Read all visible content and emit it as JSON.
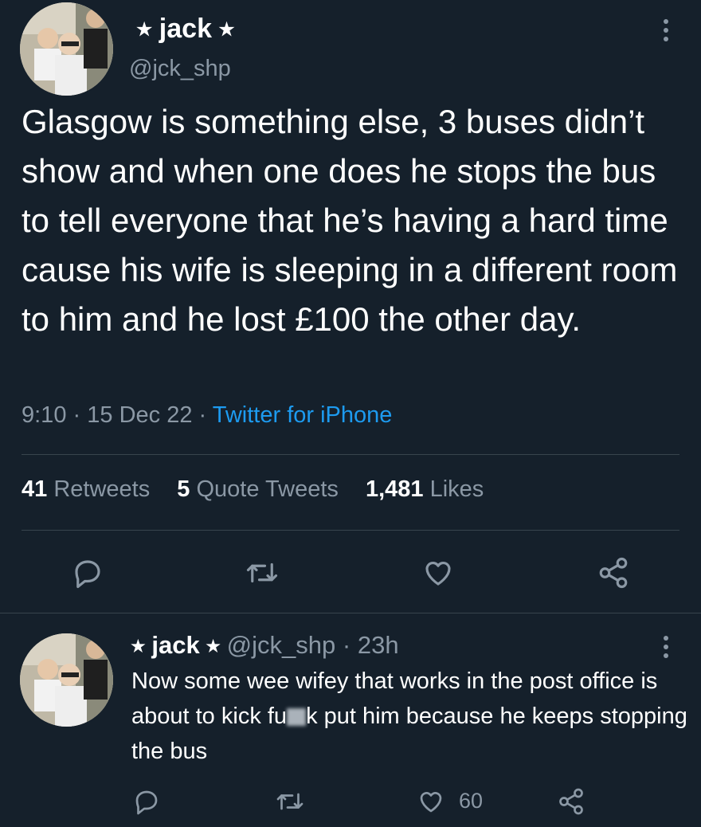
{
  "tweet": {
    "display_name": "⭑ jack ⭑",
    "handle": "@jck_shp",
    "text": "Glasgow is something else, 3 buses didn’t show and when one does he stops the bus to tell everyone that he’s having a hard time cause his wife is sleeping in a different room to him and he lost £100 the other day.",
    "time": "9:10",
    "date": "15 Dec 22",
    "separator": "·",
    "source": "Twitter for iPhone",
    "stats": {
      "retweets_count": "41",
      "retweets_label": "Retweets",
      "quotes_count": "5",
      "quotes_label": "Quote Tweets",
      "likes_count": "1,481",
      "likes_label": "Likes"
    }
  },
  "reply": {
    "display_name": "⭑ jack ⭑",
    "handle": "@jck_shp",
    "separator": "·",
    "age": "23h",
    "text_part1": "Now some wee wifey that works in the post office is about to kick fu",
    "text_part2": "k put him because he keeps stopping the bus",
    "like_count": "60"
  },
  "icons": [
    "more-icon",
    "reply-icon",
    "retweet-icon",
    "like-icon",
    "share-icon"
  ],
  "colors": {
    "background": "#15202b",
    "text": "#ffffff",
    "muted": "#8b98a5",
    "link": "#1d9bf0",
    "divider": "#38444d"
  }
}
